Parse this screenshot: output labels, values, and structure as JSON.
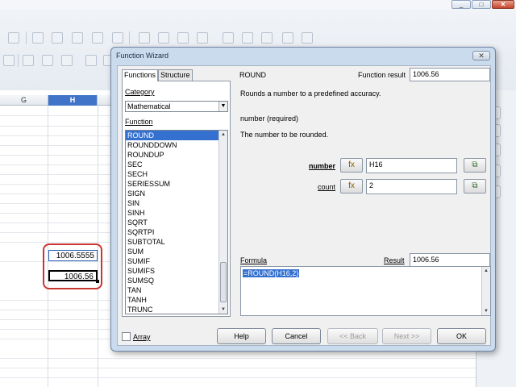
{
  "window": {
    "minimize": "_",
    "maximize": "□",
    "close": "✕"
  },
  "sheet": {
    "col_g": "G",
    "col_h": "H",
    "cell_h16": "1006.5555",
    "cell_h17": "1006.56"
  },
  "dialog": {
    "title": "Function Wizard",
    "close": "✕",
    "tabs": {
      "functions": "Functions",
      "structure": "Structure"
    },
    "category_label": "Category",
    "category_value": "Mathematical",
    "function_label": "Function",
    "functions": [
      "ROUND",
      "ROUNDDOWN",
      "ROUNDUP",
      "SEC",
      "SECH",
      "SERIESSUM",
      "SIGN",
      "SIN",
      "SINH",
      "SQRT",
      "SQRTPI",
      "SUBTOTAL",
      "SUM",
      "SUMIF",
      "SUMIFS",
      "SUMSQ",
      "TAN",
      "TANH",
      "TRUNC"
    ],
    "selected_function": "ROUND",
    "function_name": "ROUND",
    "function_result_label": "Function result",
    "function_result_value": "1006.56",
    "description": "Rounds a number to a predefined accuracy.",
    "arg_heading": "number (required)",
    "arg_description": "The number to be rounded.",
    "args": [
      {
        "label": "number",
        "value": "H16"
      },
      {
        "label": "count",
        "value": "2"
      }
    ],
    "fx_glyph": "fx",
    "formula_label": "Formula",
    "result_label": "Result",
    "result_value": "1006.56",
    "formula_value": "=ROUND(H16,2)",
    "array_label": "Array",
    "buttons": {
      "help": "Help",
      "cancel": "Cancel",
      "back": "<< Back",
      "next": "Next >>",
      "ok": "OK"
    }
  }
}
